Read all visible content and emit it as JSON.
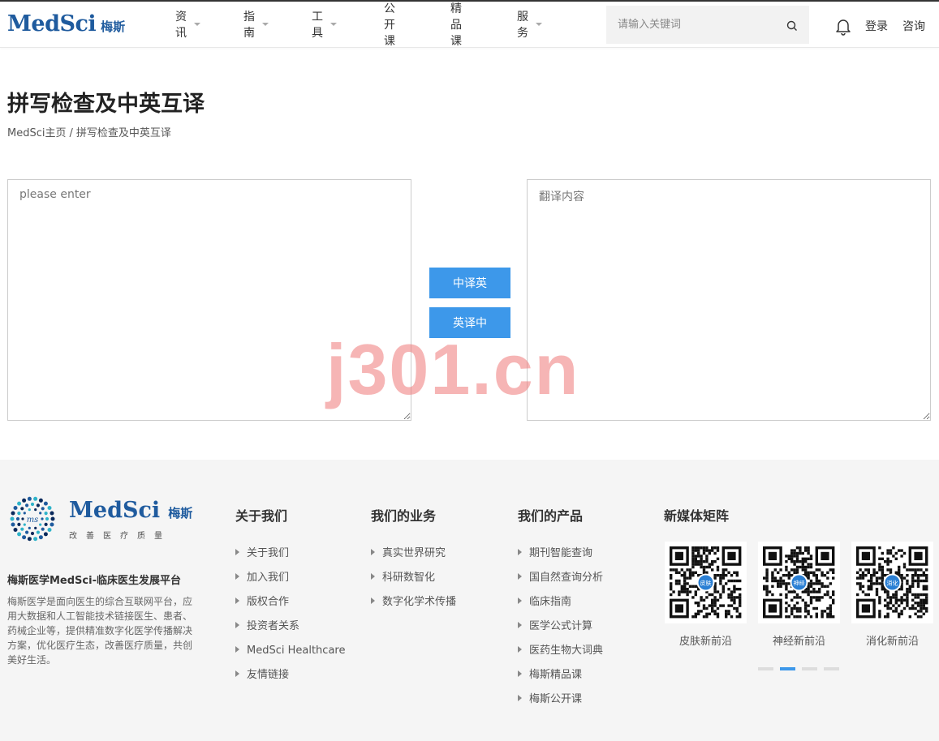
{
  "header": {
    "logo_en": "MedSci",
    "logo_cn": "梅斯",
    "nav": [
      {
        "label": "资讯",
        "dropdown": true
      },
      {
        "label": "指南",
        "dropdown": true
      },
      {
        "label": "工具",
        "dropdown": true
      },
      {
        "label": "公开课",
        "dropdown": false
      },
      {
        "label": "精品课",
        "dropdown": false
      },
      {
        "label": "服务",
        "dropdown": true
      }
    ],
    "search_placeholder": "请输入关键词",
    "login": "登录",
    "consult": "咨询"
  },
  "page": {
    "title": "拼写检查及中英互译",
    "breadcrumb": {
      "home": "MedSci主页",
      "separator": "/",
      "current": "拼写检查及中英互译"
    }
  },
  "translator": {
    "input_placeholder": "please enter",
    "output_placeholder": "翻译内容",
    "zh_to_en": "中译英",
    "en_to_zh": "英译中"
  },
  "watermark": "j301.cn",
  "footer": {
    "logo_en": "MedSci",
    "logo_cn": "梅斯",
    "logo_slogan": "改善医疗质量",
    "tagline": "梅斯医学MedSci-临床医生发展平台",
    "description": "梅斯医学是面向医生的综合互联网平台，应用大数据和人工智能技术链接医生、患者、药械企业等，提供精准数字化医学传播解决方案，优化医疗生态，改善医疗质量，共创美好生活。",
    "columns": [
      {
        "title": "关于我们",
        "items": [
          "关于我们",
          "加入我们",
          "版权合作",
          "投资者关系",
          "MedSci Healthcare",
          "友情链接"
        ]
      },
      {
        "title": "我们的业务",
        "items": [
          "真实世界研究",
          "科研数智化",
          "数字化学术传播"
        ]
      },
      {
        "title": "我们的产品",
        "items": [
          "期刊智能查询",
          "国自然查询分析",
          "临床指南",
          "医学公式计算",
          "医药生物大词典",
          "梅斯精品课",
          "梅斯公开课"
        ]
      }
    ],
    "media": {
      "title": "新媒体矩阵",
      "qrs": [
        {
          "label": "皮肤新前沿",
          "center": "皮肤"
        },
        {
          "label": "神经新前沿",
          "center": "神经"
        },
        {
          "label": "消化新前沿",
          "center": "消化"
        }
      ],
      "active_dot": 2,
      "dot_count": 4
    }
  },
  "colors": {
    "brand": "#1f5b9e",
    "accent": "#3d98ea"
  }
}
